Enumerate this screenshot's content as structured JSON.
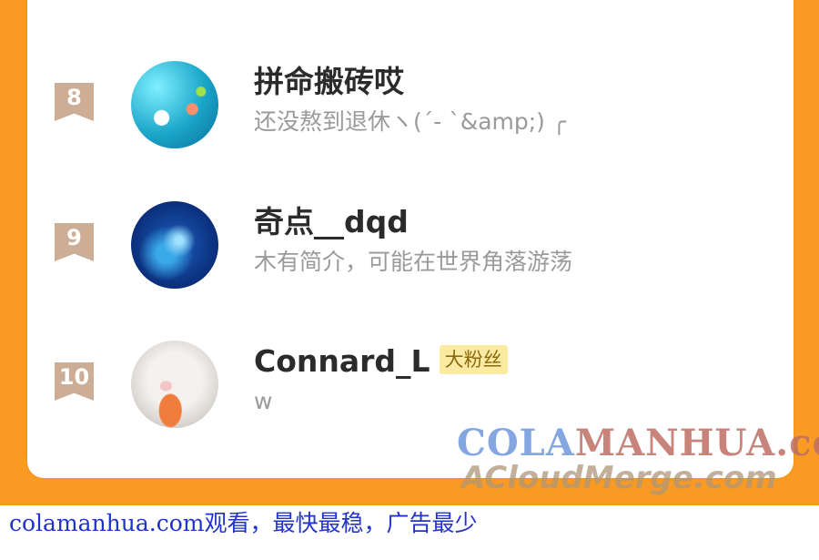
{
  "fans_list": {
    "items": [
      {
        "rank": "8",
        "name": "拼命搬砖哎",
        "desc": "还没熬到退休ヽ(ˊ- ˋ&amp;) ╭",
        "badge": ""
      },
      {
        "rank": "9",
        "name": "奇点__dqd",
        "desc": "木有简介，可能在世界角落游荡",
        "badge": ""
      },
      {
        "rank": "10",
        "name": "Connard_L",
        "desc": "w",
        "badge": "大粉丝"
      }
    ]
  },
  "watermark": {
    "line1_a": "COLA",
    "line1_b": "MANHUA.com",
    "line2": "ACloudMerge.com"
  },
  "footer": {
    "text": "colamanhua.com观看，最快最稳，广告最少"
  },
  "colors": {
    "frame": "#f99a23",
    "rank_badge": "#ccae96",
    "fan_badge": "#fbeaa2",
    "footer_link": "#2233cc"
  }
}
